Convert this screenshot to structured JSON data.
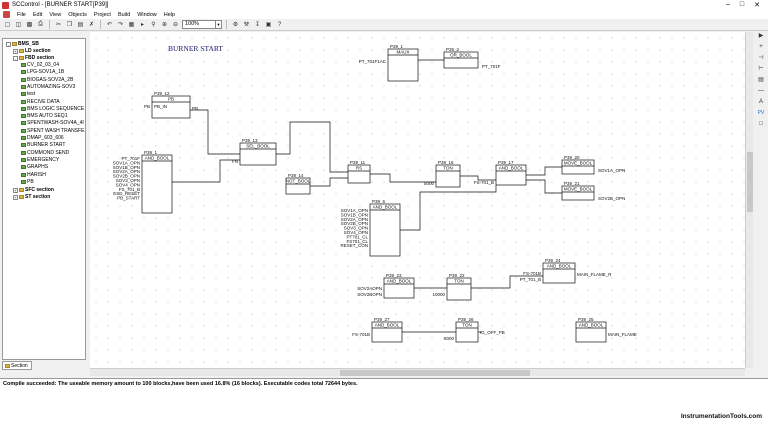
{
  "window": {
    "title": "SCControl - [BURNER START[P39]]"
  },
  "menu": [
    "File",
    "Edit",
    "View",
    "Objects",
    "Project",
    "Build",
    "Window",
    "Help"
  ],
  "toolbar": {
    "zoom": "100%"
  },
  "tree": {
    "root": "BMS_SB",
    "ld": "LD section",
    "fbd": "FBD section",
    "items": [
      "CV_02_03_04",
      "LPG-SOV1A_1B",
      "BIOGAS-SOV2A_2B",
      "AUTOMAZING-SOV3",
      "test",
      "RECIVE DATA",
      "BMS LOGIC SEQUENCE",
      "BMS AUTO SEQ1",
      "SPENTWASH-SOV4A_4I",
      "SPENT WASH TRANSFE",
      "DMAP_603_606",
      "BURNER START",
      "COMMOND SEND",
      "EMERGENCY",
      "GRAPHS",
      "HARISH",
      "PB"
    ],
    "sfc": "SFC section",
    "st": "ST section",
    "tab": "Section"
  },
  "diagram": {
    "heading": "BURNER START",
    "blocks": [
      {
        "id": "P39_1",
        "type": "MAUX"
      },
      {
        "id": "P39_2",
        "type": "OR_BOOL"
      },
      {
        "id": "P39_12",
        "type": "PB"
      },
      {
        "id": "P39_13",
        "type": "SEL_BOOL"
      },
      {
        "id": "P39_1b",
        "type": "AND_BOOL"
      },
      {
        "id": "P39_11",
        "type": "RS"
      },
      {
        "id": "P39_14",
        "type": "NOT_BOOL"
      },
      {
        "id": "P39_16",
        "type": "TON"
      },
      {
        "id": "P39_17",
        "type": "AND_BOOL"
      },
      {
        "id": "P39_20",
        "type": "MOVE_BOOL"
      },
      {
        "id": "P39_21",
        "type": "MOVE_BOOL"
      },
      {
        "id": "P39_6",
        "type": "AND_BOOL"
      },
      {
        "id": "P39_24",
        "type": "AND_BOOL"
      },
      {
        "id": "P39_23",
        "type": "AND_BOOL"
      },
      {
        "id": "P39_22",
        "type": "TON"
      },
      {
        "id": "P39_27",
        "type": "AND_BOOL"
      },
      {
        "id": "P39_26",
        "type": "TON"
      },
      {
        "id": "P39_25",
        "type": "AND_BOOL"
      }
    ],
    "signals": {
      "pt_701f1ac": "PT_701F1AC",
      "pt_701f": "PT_701F",
      "pb": "PB",
      "pb_in": "PB_IN",
      "fn": "FN",
      "sov1a_opn": "SOV1A_OPN",
      "sov2b_opn": "SOV2B_OPN",
      "fs_701_b": "FS-701_B",
      "t5000": "5000",
      "t10000": "10000",
      "t6000": "6000",
      "main_flame_r": "MAIN_FLAME_R",
      "main_flame": "MAIN_FLAME",
      "ig_off_pb": "IG_OFF_PB",
      "sov2aopn": "SOV2AOPN",
      "sov2bopn": "SOV2BOPN",
      "pt_701_b": "PT_701_B",
      "fs701b": "FS-701B",
      "pt701": "PT701_CL"
    }
  },
  "output": {
    "message": "Compile succeeded: The useable memory amount to 100 blocks,have been used 16.8% (16 blocks). Executable codes total 72644 bytes."
  },
  "watermark": "InstrumentationTools.com"
}
